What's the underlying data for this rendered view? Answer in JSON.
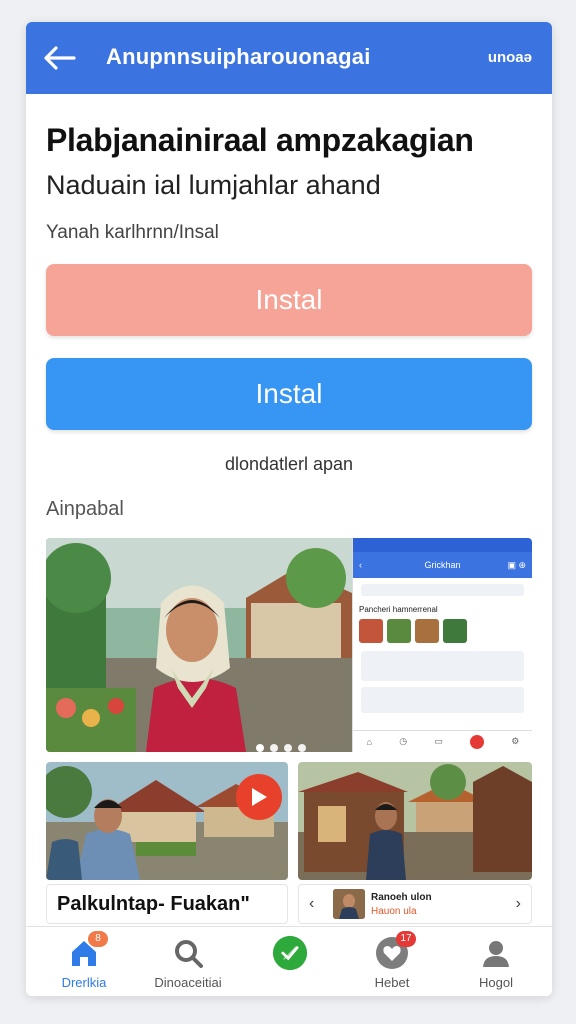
{
  "appbar": {
    "title": "Anupnnsuipharouonagai",
    "more_label": "unoaə"
  },
  "content": {
    "headline": "Plabjanainiraal ampzakagian",
    "subheadline": "Naduain ial lumjahlar ahand",
    "meta": "Yanah karlhrnn/Insal",
    "primary_button_label": "Instal",
    "secondary_button_label": "Instal",
    "note": "dlondatlerl apan",
    "section_title": "Ainpabal"
  },
  "hero": {
    "dots_count": 4,
    "screenshot": {
      "title": "Grickhan",
      "label": "Pancheri hamnerrenal"
    }
  },
  "cards": {
    "left_caption": "Palkulntap- Fuakan\"",
    "right_title": "Ranoeh ulon",
    "right_subtitle": "Hauon ula"
  },
  "bottom_nav": [
    {
      "label": "Drerlkia",
      "icon": "home-icon",
      "badge": "8",
      "active": true
    },
    {
      "label": "Dinoaceitiai",
      "icon": "search-icon",
      "badge": "",
      "active": false
    },
    {
      "label": "",
      "icon": "check-icon",
      "badge": "",
      "active": false
    },
    {
      "label": "Hebet",
      "icon": "heart-icon",
      "badge": "17",
      "active": false
    },
    {
      "label": "Hogol",
      "icon": "profile-icon",
      "badge": "",
      "active": false
    }
  ],
  "colors": {
    "primary": "#3b73e0",
    "button_salmon": "#f6a497",
    "button_blue": "#3795f3",
    "play_red": "#e8412b",
    "fab_green": "#2eaa3c"
  }
}
